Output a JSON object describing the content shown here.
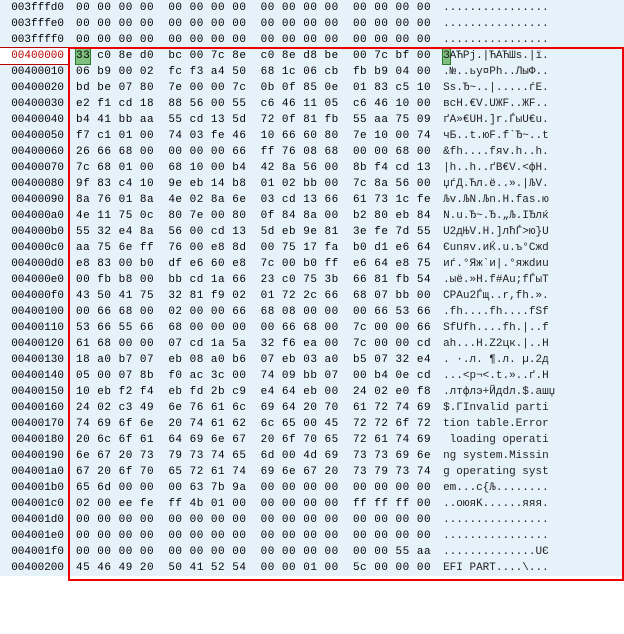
{
  "highlight_address_index": 3,
  "highlight_byte_row": 3,
  "redbox": {
    "top_row": 3,
    "bottom_row": 35
  },
  "rows": [
    {
      "addr": "003fffd0",
      "hex": "00 00 00 00  00 00 00 00  00 00 00 00  00 00 00 00",
      "asc": "................"
    },
    {
      "addr": "003fffe0",
      "hex": "00 00 00 00  00 00 00 00  00 00 00 00  00 00 00 00",
      "asc": "................"
    },
    {
      "addr": "003ffff0",
      "hex": "00 00 00 00  00 00 00 00  00 00 00 00  00 00 00 00",
      "asc": "................"
    },
    {
      "addr": "00400000",
      "hex": "33 c0 8e d0  bc 00 7c 8e  c0 8e d8 be  00 7c bf 00",
      "asc": "ЗАЋРј.|ЋАЋШѕ.|ї."
    },
    {
      "addr": "00400010",
      "hex": "06 b9 00 02  fc f3 a4 50  68 1c 06 cb  fb b9 04 00",
      "asc": ".№..ьу¤Ph..ЛыФ.."
    },
    {
      "addr": "00400020",
      "hex": "bd be 07 80  7e 00 00 7c  0b 0f 85 0e  01 83 c5 10",
      "asc": "Sѕ.Ђ~..|.....ѓЕ."
    },
    {
      "addr": "00400030",
      "hex": "e2 f1 cd 18  88 56 00 55  c6 46 11 05  c6 46 10 00",
      "asc": "всН.€V.UЖF..ЖF.."
    },
    {
      "addr": "00400040",
      "hex": "b4 41 bb aa  55 cd 13 5d  72 0f 81 fb  55 aa 75 09",
      "asc": "ґA»€UН.]r.ЃыU€u."
    },
    {
      "addr": "00400050",
      "hex": "f7 c1 01 00  74 03 fe 46  10 66 60 80  7e 10 00 74",
      "asc": "чБ..t.юF.f`Ђ~..t"
    },
    {
      "addr": "00400060",
      "hex": "26 66 68 00  00 00 00 66  ff 76 08 68  00 00 68 00",
      "asc": "&fh....fяv.h..h."
    },
    {
      "addr": "00400070",
      "hex": "7c 68 01 00  68 10 00 b4  42 8a 56 00  8b f4 cd 13",
      "asc": "|h..h..ґB€V.<фН."
    },
    {
      "addr": "00400080",
      "hex": "9f 83 c4 10  9e eb 14 b8  01 02 bb 00  7c 8a 56 00",
      "asc": "џѓД.Ћл.ё..».|ЉV."
    },
    {
      "addr": "00400090",
      "hex": "8a 76 01 8a  4e 02 8a 6e  03 cd 13 66  61 73 1c fe",
      "asc": "Љv.ЉN.Љn.Н.fas.ю"
    },
    {
      "addr": "004000a0",
      "hex": "4e 11 75 0c  80 7e 00 80  0f 84 8a 00  b2 80 eb 84",
      "asc": "N.u.Ђ~.Ђ.„Љ.ІЂлќ"
    },
    {
      "addr": "004000b0",
      "hex": "55 32 e4 8a  56 00 cd 13  5d eb 9e 81  3e fe 7d 55",
      "asc": "U2дЊV.Н.]лћЃ>ю}U"
    },
    {
      "addr": "004000c0",
      "hex": "aa 75 6e ff  76 00 e8 8d  00 75 17 fa  b0 d1 e6 64",
      "asc": "Єunяv.иЌ.u.ъ°Сжd"
    },
    {
      "addr": "004000d0",
      "hex": "e8 83 00 b0  df e6 60 e8  7c 00 b0 ff  e6 64 e8 75",
      "asc": "иѓ.°Яж`и|.°яжdиu"
    },
    {
      "addr": "004000e0",
      "hex": "00 fb b8 00  bb cd 1a 66  23 c0 75 3b  66 81 fb 54",
      "asc": ".ыё.»Н.f#Au;fЃыT"
    },
    {
      "addr": "004000f0",
      "hex": "43 50 41 75  32 81 f9 02  01 72 2c 66  68 07 bb 00",
      "asc": "CPAu2Ѓщ..r,fh.»."
    },
    {
      "addr": "00400100",
      "hex": "00 66 68 00  02 00 00 66  68 08 00 00  00 66 53 66",
      "asc": ".fh....fh....fSf"
    },
    {
      "addr": "00400110",
      "hex": "53 66 55 66  68 00 00 00  00 66 68 00  7c 00 00 66",
      "asc": "SfUfh....fh.|..f"
    },
    {
      "addr": "00400120",
      "hex": "61 68 00 00  07 cd 1a 5a  32 f6 ea 00  7c 00 00 cd",
      "asc": "ah...Н.Z2цк.|..Н"
    },
    {
      "addr": "00400130",
      "hex": "18 a0 b7 07  eb 08 a0 b6  07 eb 03 a0  b5 07 32 e4",
      "asc": ". ·.л. ¶.л. µ.2д"
    },
    {
      "addr": "00400140",
      "hex": "05 00 07 8b  f0 ac 3c 00  74 09 bb 07  00 b4 0e cd",
      "asc": "...<р¬<.t.»..ґ.Н"
    },
    {
      "addr": "00400150",
      "hex": "10 eb f2 f4  eb fd 2b c9  e4 64 eb 00  24 02 e0 f8",
      "asc": ".лтфлэ+Йдdл.$.ашџ"
    },
    {
      "addr": "00400160",
      "hex": "24 02 c3 49  6e 76 61 6c  69 64 20 70  61 72 74 69",
      "asc": "$.ГInvalid parti"
    },
    {
      "addr": "00400170",
      "hex": "74 69 6f 6e  20 74 61 62  6c 65 00 45  72 72 6f 72",
      "asc": "tion table.Error"
    },
    {
      "addr": "00400180",
      "hex": "20 6c 6f 61  64 69 6e 67  20 6f 70 65  72 61 74 69",
      "asc": " loading operati"
    },
    {
      "addr": "00400190",
      "hex": "6e 67 20 73  79 73 74 65  6d 00 4d 69  73 73 69 6e",
      "asc": "ng system.Missin"
    },
    {
      "addr": "004001a0",
      "hex": "67 20 6f 70  65 72 61 74  69 6e 67 20  73 79 73 74",
      "asc": "g operating syst"
    },
    {
      "addr": "004001b0",
      "hex": "65 6d 00 00  00 63 7b 9a  00 00 00 00  00 00 00 00",
      "asc": "em...c{Љ........"
    },
    {
      "addr": "004001c0",
      "hex": "02 00 ee fe  ff 4b 01 00  00 00 00 00  ff ff ff 00",
      "asc": "..оюяK......яяя."
    },
    {
      "addr": "004001d0",
      "hex": "00 00 00 00  00 00 00 00  00 00 00 00  00 00 00 00",
      "asc": "................"
    },
    {
      "addr": "004001e0",
      "hex": "00 00 00 00  00 00 00 00  00 00 00 00  00 00 00 00",
      "asc": "................"
    },
    {
      "addr": "004001f0",
      "hex": "00 00 00 00  00 00 00 00  00 00 00 00  00 00 55 aa",
      "asc": "..............UЄ"
    },
    {
      "addr": "00400200",
      "hex": "45 46 49 20  50 41 52 54  00 00 01 00  5c 00 00 00",
      "asc": "EFI PART....\\..."
    }
  ]
}
